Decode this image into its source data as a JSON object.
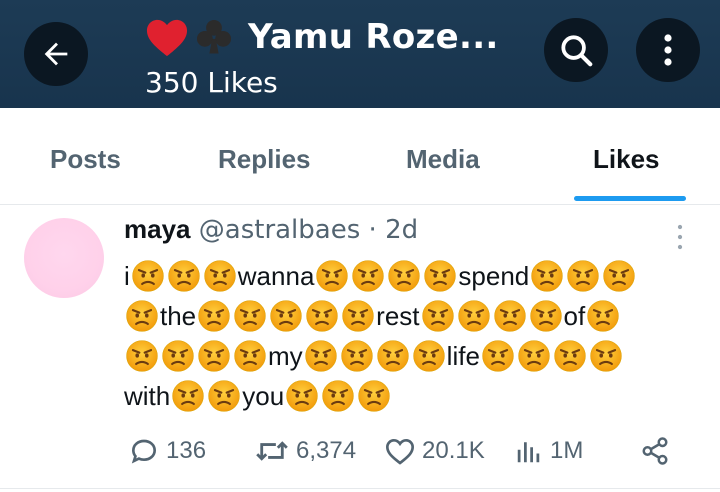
{
  "header": {
    "title_emoji": [
      "heart",
      "club"
    ],
    "title": "Yamu Roze...",
    "likes_count": "350 Likes",
    "back_icon": "back-arrow-icon",
    "search_icon": "search-icon",
    "more_icon": "more-vertical-icon"
  },
  "tabs": [
    {
      "label": "Posts"
    },
    {
      "label": "Replies"
    },
    {
      "label": "Media"
    },
    {
      "label": "Likes",
      "active": true
    }
  ],
  "post": {
    "name": "maya",
    "handle": "@astralbaes",
    "dot": " · ",
    "time": "2d",
    "lines": [
      [
        "i",
        "E3",
        "wanna",
        "E4",
        "spend",
        "E3"
      ],
      [
        "E1",
        "the",
        "E5",
        "rest",
        "E4",
        "of",
        "E1"
      ],
      [
        "E4",
        "my",
        "E4",
        "life",
        "E4"
      ],
      [
        "with",
        "E2",
        "you",
        "E3"
      ]
    ],
    "emoji": "angry-face",
    "actions": {
      "replies": "136",
      "reposts": "6,374",
      "likes": "20.1K",
      "views": "1M"
    }
  },
  "colors": {
    "header_bg": "#1d3b55",
    "accent": "#1d9bf0",
    "muted": "#536471",
    "avatar": "#ffd1ea"
  }
}
